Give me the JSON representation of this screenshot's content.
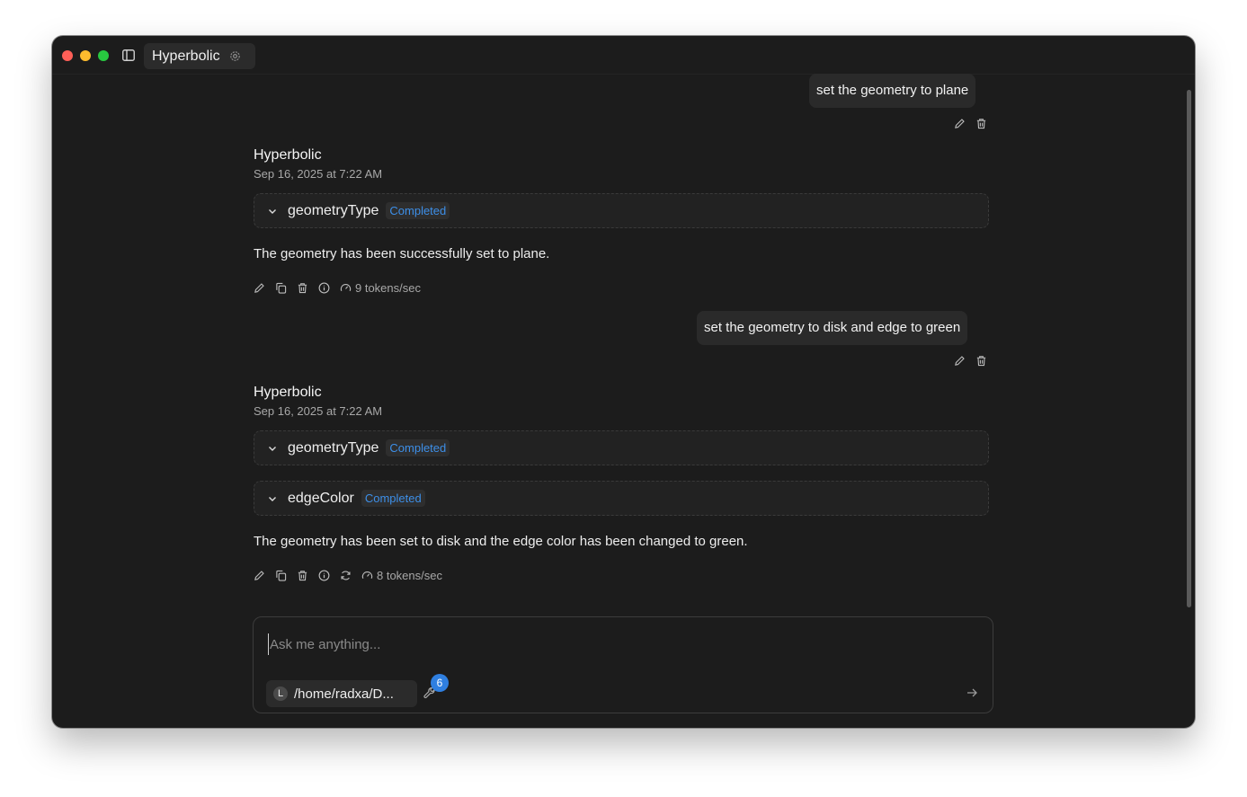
{
  "window": {
    "title": "Hyperbolic"
  },
  "icons": {
    "sidebar": "sidebar-icon",
    "settings": "gear-icon",
    "edit": "pencil-icon",
    "delete": "trash-icon",
    "copy": "copy-icon",
    "info": "info-icon",
    "speed": "gauge-icon",
    "regenerate": "refresh-icon",
    "expand": "chevron-down-icon",
    "tools": "wrench-icon",
    "send": "arrow-right-icon"
  },
  "colors": {
    "background": "#1c1c1c",
    "bubble": "#2a2a2a",
    "accent": "#3d8fe8",
    "badge": "#2f7fe0"
  },
  "conversation": {
    "user_messages": [
      {
        "text": "set the geometry to plane"
      },
      {
        "text": "set the geometry to disk and edge to green"
      }
    ],
    "assistant_messages": [
      {
        "name": "Hyperbolic",
        "time": "Sep 16, 2025 at 7:22 AM",
        "tools": [
          {
            "name": "geometryType",
            "status": "Completed"
          }
        ],
        "text": "The geometry has been successfully set to plane.",
        "speed": "9 tokens/sec"
      },
      {
        "name": "Hyperbolic",
        "time": "Sep 16, 2025 at 7:22 AM",
        "tools": [
          {
            "name": "geometryType",
            "status": "Completed"
          },
          {
            "name": "edgeColor",
            "status": "Completed"
          }
        ],
        "text": "The geometry has been set to disk and the edge color has been changed to green.",
        "speed": "8 tokens/sec"
      }
    ]
  },
  "composer": {
    "placeholder": "Ask me anything...",
    "path_initial": "L",
    "path": "/home/radxa/D...",
    "tools_count": "6"
  }
}
